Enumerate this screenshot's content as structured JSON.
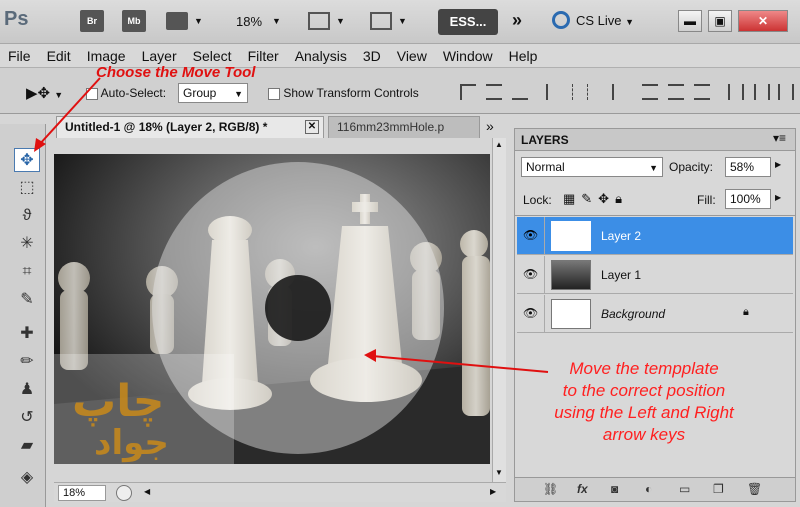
{
  "app": {
    "logo": "Ps",
    "bridge_label": "Br",
    "minibridge_label": "Mb",
    "zoom": "18%",
    "essentials": "ESS...",
    "more": "»",
    "cslive": "CS Live"
  },
  "menu": [
    "File",
    "Edit",
    "Image",
    "Layer",
    "Select",
    "Filter",
    "Analysis",
    "3D",
    "View",
    "Window",
    "Help"
  ],
  "options": {
    "auto_select_label": "Auto-Select:",
    "auto_select_value": "Group",
    "transform_label": "Show Transform Controls"
  },
  "doc": {
    "tab_active": "Untitled-1 @ 18% (Layer 2, RGB/8) *",
    "tab_inactive": "116mm23mmHole.p",
    "zoom": "18%"
  },
  "layers_panel": {
    "title": "LAYERS",
    "blend_mode": "Normal",
    "opacity_label": "Opacity:",
    "opacity": "58%",
    "lock_label": "Lock:",
    "fill_label": "Fill:",
    "fill": "100%",
    "layers": [
      {
        "name": "Layer 2",
        "selected": true
      },
      {
        "name": "Layer 1",
        "selected": false
      },
      {
        "name": "Background",
        "selected": false
      }
    ]
  },
  "annotations": {
    "choose_tool": "Choose the Move Tool",
    "move_line1": "Move the tempplate",
    "move_line2": "to the correct position",
    "move_line3": "using the Left and Right",
    "move_line4": "arrow keys"
  },
  "colors": {
    "selection_blue": "#3c8ee6",
    "annotation_red": "#e01010"
  }
}
